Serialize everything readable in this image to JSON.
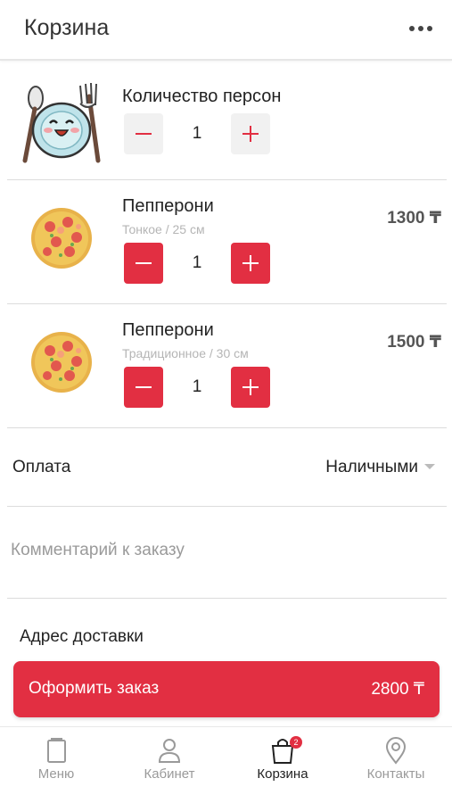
{
  "header": {
    "title": "Корзина",
    "menu_icon": "more-horizontal-icon"
  },
  "persons": {
    "title": "Количество персон",
    "quantity": "1",
    "image": "plate-mascot-icon"
  },
  "items": [
    {
      "name": "Пепперони",
      "variant": "Тонкое / 25 см",
      "price": "1300 ₸",
      "quantity": "1",
      "image": "pizza-image"
    },
    {
      "name": "Пепперони",
      "variant": "Традиционное / 30 см",
      "price": "1500 ₸",
      "quantity": "1",
      "image": "pizza-image"
    }
  ],
  "payment": {
    "label": "Оплата",
    "value": "Наличными"
  },
  "comment": {
    "placeholder": "Комментарий к заказу"
  },
  "address": {
    "label": "Адрес доставки"
  },
  "checkout": {
    "label": "Оформить заказ",
    "total": "2800 ₸"
  },
  "tabbar": {
    "tabs": [
      {
        "label": "Меню",
        "icon": "menu-book-icon"
      },
      {
        "label": "Кабинет",
        "icon": "user-icon"
      },
      {
        "label": "Корзина",
        "icon": "shopping-bag-icon",
        "badge": "2",
        "active": true
      },
      {
        "label": "Контакты",
        "icon": "location-pin-icon"
      }
    ]
  },
  "colors": {
    "accent": "#e22f42",
    "muted_text": "#9a9a9a"
  }
}
